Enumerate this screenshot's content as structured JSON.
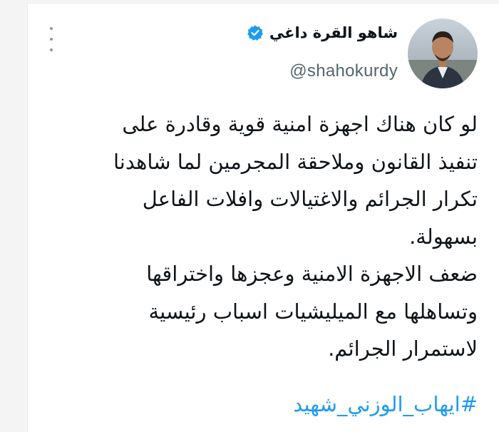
{
  "author": {
    "display_name": "شاهو القرة داغي",
    "handle": "@shahokurdy",
    "verified": true,
    "avatar_icon": "profile-photo"
  },
  "tweet": {
    "lines": [
      "لو كان هناك اجهزة امنية قوية وقادرة على",
      "تنفيذ القانون وملاحقة المجرمين لما شاهدنا",
      "تكرار الجرائم والاغتيالات وافلات الفاعل",
      "بسهولة.",
      "ضعف الاجهزة الامنية وعجزها واختراقها",
      "وتساهلها مع الميليشيات اسباب رئيسية",
      "لاستمرار الجرائم."
    ],
    "hashtag": "#ايهاب_الوزني_شهيد"
  },
  "colors": {
    "verified_badge": "#1d9bf0",
    "hashtag": "#1d9bf0",
    "text": "#0f1419",
    "handle": "#536471"
  }
}
